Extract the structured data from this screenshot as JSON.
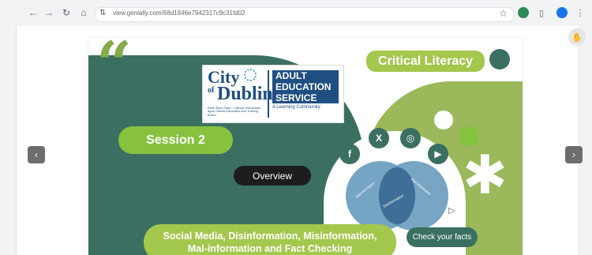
{
  "browser": {
    "url": "view.genially.com/68d1846e7942317c9c31fd02",
    "nav_icons": [
      "back-arrow-icon",
      "forward-arrow-icon",
      "reload-icon",
      "home-icon"
    ],
    "toolbar_right_icons": [
      "star-icon",
      "extension-icon",
      "puzzle-icon",
      "profile-icon",
      "menu-dots-icon"
    ]
  },
  "viewer": {
    "prev_icon": "chevron-left-icon",
    "next_icon": "chevron-right-icon",
    "corner_icon": "pan-icon"
  },
  "slide": {
    "title": "Critical Literacy",
    "session": "Session 2",
    "overview_button": "Overview",
    "check_button": "Check your facts",
    "subtitle_line1": "Social Media, Disinformation, Misinformation,",
    "subtitle_line2": "Mal-information and Fact Checking",
    "logo": {
      "city": "City",
      "of": "of",
      "dublin": "Dublin",
      "small_text": "Baile Átha Cliath - Cathair Oideachais agus Oiliúna Education and Training Board",
      "aes_line1": "ADULT",
      "aes_line2": "EDUCATION",
      "aes_line3": "SERVICE",
      "tagline": "A Learning Community"
    },
    "venn_labels": {
      "left": "Misinformation",
      "right": "Mal-information",
      "center": "Disinformation"
    },
    "social_icons": [
      "facebook-icon",
      "x-icon",
      "instagram-icon",
      "youtube-icon"
    ],
    "colors": {
      "teal": "#3b6f62",
      "green": "#a4c74e",
      "lime": "#87c23f",
      "venn_blue": "#5f95b8"
    }
  }
}
